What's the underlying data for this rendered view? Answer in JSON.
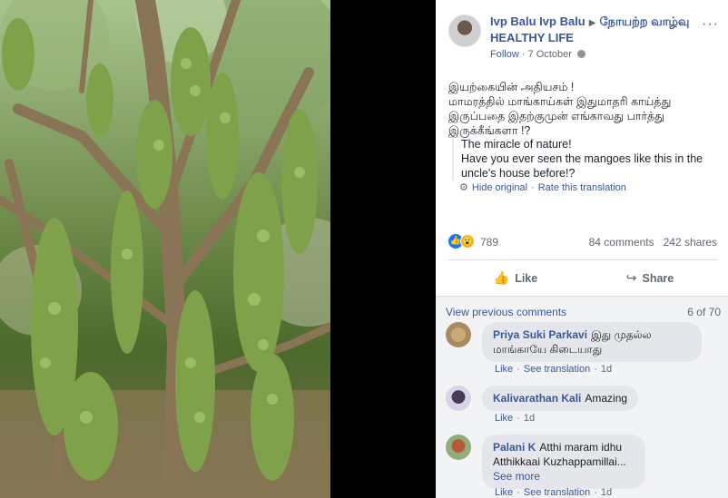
{
  "post": {
    "author": "Ivp Balu Ivp Balu",
    "group": "நோயற்ற வாழ்வு HEALTHY LIFE",
    "follow_label": "Follow",
    "date": "7 October",
    "more_label": "···",
    "text_line1": "இயற்கையின் அதியசம் !",
    "text_line2": "மாமரத்தில் மாங்காய்கள் இதுமாதரி காய்த்து இருப்பதை இதற்குமுன் எங்காவது பார்த்து இருக்கீங்களா !?",
    "translation_line1": "The miracle of nature!",
    "translation_line2": "Have you ever seen the mangoes like this in the uncle's house before!?",
    "hide_original": "Hide original",
    "rate_translation": "Rate this translation",
    "reaction_count": "789",
    "comments_count": "84 comments",
    "shares_count": "242 shares",
    "like_label": "Like",
    "share_label": "Share"
  },
  "comments_section": {
    "view_previous": "View previous comments",
    "counter": "6 of 70",
    "items": [
      {
        "name": "Priya Suki Parkavi",
        "text": "இது முதல்ல மாங்காயே கிடையாது",
        "like": "Like",
        "see_translation": "See translation",
        "time": "1d"
      },
      {
        "name": "Kalivarathan Kali",
        "text": "Amazing",
        "like": "Like",
        "time": "1d"
      },
      {
        "name": "Palani K",
        "text": "Atthi maram idhu Atthikkaai Kuzhappamillai...",
        "see_more": "See more",
        "like": "Like",
        "see_translation": "See translation",
        "time": "1d"
      }
    ]
  },
  "colors": {
    "link_blue": "#385898",
    "meta_grey": "#606770",
    "comments_bg": "#f2f3f5"
  }
}
